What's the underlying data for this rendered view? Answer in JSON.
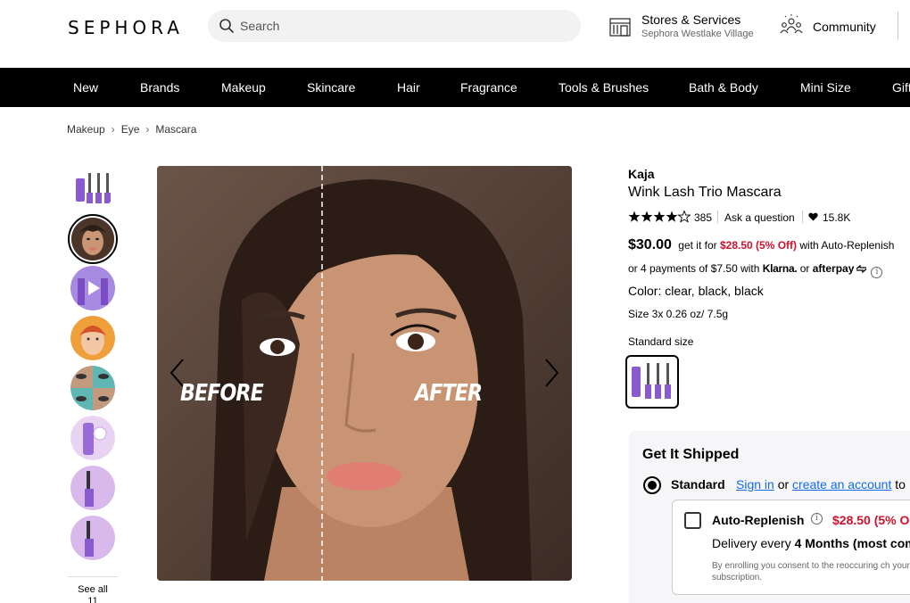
{
  "header": {
    "logo": "SEPHORA",
    "search_placeholder": "Search",
    "stores_title": "Stores & Services",
    "stores_subtitle": "Sephora Westlake Village",
    "community": "Community"
  },
  "nav": [
    "New",
    "Brands",
    "Makeup",
    "Skincare",
    "Hair",
    "Fragrance",
    "Tools & Brushes",
    "Bath & Body",
    "Mini Size",
    "Gifts"
  ],
  "breadcrumb": [
    "Makeup",
    "Eye",
    "Mascara"
  ],
  "gallery": {
    "see_all_line1": "See all",
    "see_all_line2": "11",
    "before_label": "BEFORE",
    "after_label": "AFTER"
  },
  "product": {
    "brand": "Kaja",
    "name": "Wink Lash Trio Mascara",
    "rating": 4.5,
    "review_count": "385",
    "ask": "Ask a question",
    "loves": "15.8K",
    "price": "$30.00",
    "replenish_pre": "get it for",
    "replenish_price": "$28.50 (5% Off)",
    "replenish_post": "with Auto-Replenish",
    "installments_pre": "or 4 payments of $7.50 with",
    "klarna": "Klarna.",
    "or": "or",
    "afterpay": "afterpay",
    "color": "Color: clear, black, black",
    "size": "Size 3x 0.26 oz/ 7.5g",
    "size_type": "Standard size"
  },
  "shipping": {
    "title": "Get It Shipped",
    "standard": "Standard",
    "sign_in": "Sign in",
    "or": "or",
    "create_account": "create an account",
    "to": "to",
    "auto_replenish": "Auto-Replenish",
    "ar_price": "$28.50 (5% O",
    "delivery_pre": "Delivery every",
    "delivery_freq": "4 Months (most com",
    "consent": "By enrolling you consent to the reoccuring ch your subscription."
  },
  "colors": {
    "sale_red": "#cf112c",
    "link_blue": "#136bea",
    "nav_bg": "#000000",
    "product_purple": "#8a5bd0"
  }
}
